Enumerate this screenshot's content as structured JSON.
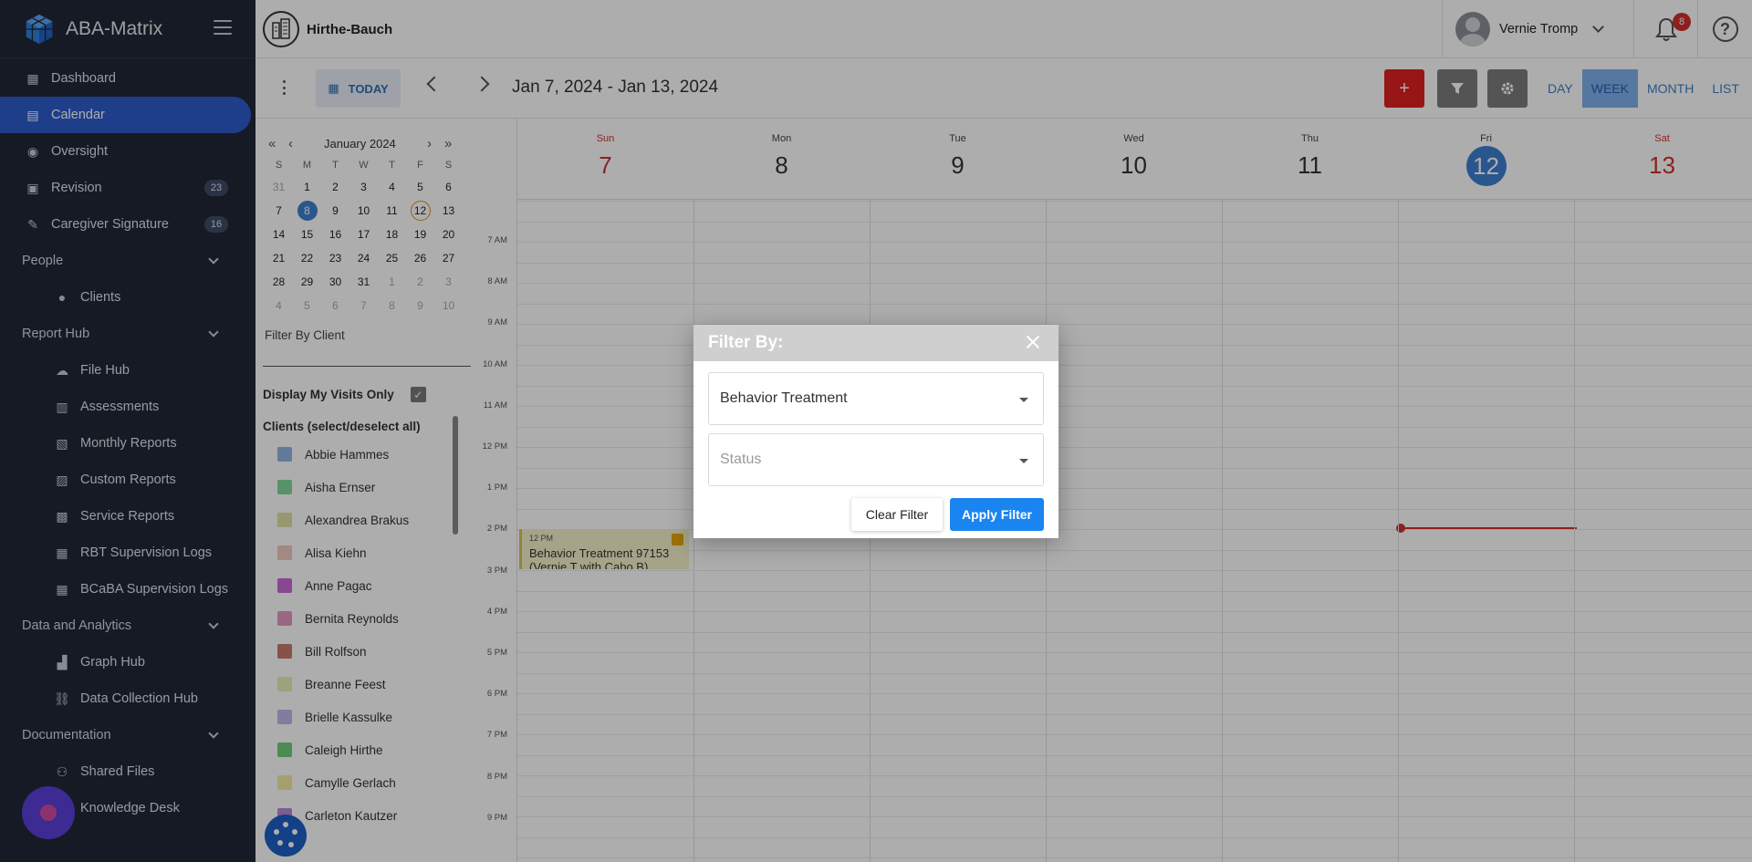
{
  "app": {
    "name": "ABA-Matrix"
  },
  "sidebar": {
    "items": [
      {
        "label": "Dashboard"
      },
      {
        "label": "Calendar"
      },
      {
        "label": "Oversight"
      },
      {
        "label": "Revision",
        "badge": "23"
      },
      {
        "label": "Caregiver Signature",
        "badge": "16"
      },
      {
        "label": "People"
      },
      {
        "label": "Clients"
      },
      {
        "label": "Report Hub"
      },
      {
        "label": "File Hub"
      },
      {
        "label": "Assessments"
      },
      {
        "label": "Monthly Reports"
      },
      {
        "label": "Custom Reports"
      },
      {
        "label": "Service Reports"
      },
      {
        "label": "RBT Supervision Logs"
      },
      {
        "label": "BCaBA Supervision Logs"
      },
      {
        "label": "Data and Analytics"
      },
      {
        "label": "Graph Hub"
      },
      {
        "label": "Data Collection Hub"
      },
      {
        "label": "Documentation"
      },
      {
        "label": "Shared Files"
      },
      {
        "label": "Knowledge Desk"
      }
    ]
  },
  "header": {
    "org_name": "Hirthe-Bauch",
    "user_name": "Vernie Tromp",
    "notifications": "8",
    "help": "?"
  },
  "toolbar": {
    "today": "TODAY",
    "date_range": "Jan 7, 2024 - Jan 13, 2024",
    "add": "+",
    "views": [
      "DAY",
      "WEEK",
      "MONTH",
      "LIST"
    ],
    "active_view": "WEEK"
  },
  "mini_calendar": {
    "title": "January 2024",
    "dow": [
      "S",
      "M",
      "T",
      "W",
      "T",
      "F",
      "S"
    ],
    "weeks": [
      [
        "31",
        "1",
        "2",
        "3",
        "4",
        "5",
        "6"
      ],
      [
        "7",
        "8",
        "9",
        "10",
        "11",
        "12",
        "13"
      ],
      [
        "14",
        "15",
        "16",
        "17",
        "18",
        "19",
        "20"
      ],
      [
        "21",
        "22",
        "23",
        "24",
        "25",
        "26",
        "27"
      ],
      [
        "28",
        "29",
        "30",
        "31",
        "1",
        "2",
        "3"
      ],
      [
        "4",
        "5",
        "6",
        "7",
        "8",
        "9",
        "10"
      ]
    ],
    "selected": "8",
    "today": "12"
  },
  "left_panel": {
    "filter_by_client": "Filter By Client",
    "display_my_visits": "Display My Visits Only",
    "clients_title": "Clients (select/deselect all)",
    "clients": [
      {
        "name": "Abbie Hammes",
        "color": "#8fb6e0"
      },
      {
        "name": "Aisha Ernser",
        "color": "#7fd99a"
      },
      {
        "name": "Alexandrea Brakus",
        "color": "#dfe0a6"
      },
      {
        "name": "Alisa Kiehn",
        "color": "#f2c9c0"
      },
      {
        "name": "Anne Pagac",
        "color": "#c86ad6"
      },
      {
        "name": "Bernita Reynolds",
        "color": "#e09ac2"
      },
      {
        "name": "Bill Rolfson",
        "color": "#c87a6a"
      },
      {
        "name": "Breanne Feest",
        "color": "#e6efb6"
      },
      {
        "name": "Brielle Kassulke",
        "color": "#c3b6ec"
      },
      {
        "name": "Caleigh Hirthe",
        "color": "#6ecf78"
      },
      {
        "name": "Camylle Gerlach",
        "color": "#f3eaa6"
      },
      {
        "name": "Carleton Kautzer",
        "color": "#b68ad8"
      }
    ]
  },
  "calendar": {
    "days": [
      {
        "name": "Sun",
        "num": "7"
      },
      {
        "name": "Mon",
        "num": "8"
      },
      {
        "name": "Tue",
        "num": "9"
      },
      {
        "name": "Wed",
        "num": "10"
      },
      {
        "name": "Thu",
        "num": "11"
      },
      {
        "name": "Fri",
        "num": "12"
      },
      {
        "name": "Sat",
        "num": "13"
      }
    ],
    "hours": [
      "7 AM",
      "8 AM",
      "9 AM",
      "10 AM",
      "11 AM",
      "12 PM",
      "1 PM",
      "2 PM",
      "3 PM",
      "4 PM",
      "5 PM",
      "6 PM",
      "7 PM",
      "8 PM",
      "9 PM"
    ],
    "event": {
      "time": "12 PM",
      "title": "Behavior Treatment 97153",
      "subtitle": "(Vernie T with Cabo B)"
    }
  },
  "modal": {
    "title": "Filter By:",
    "service_value": "Behavior Treatment",
    "status_placeholder": "Status",
    "clear_label": "Clear Filter",
    "apply_label": "Apply Filter"
  }
}
